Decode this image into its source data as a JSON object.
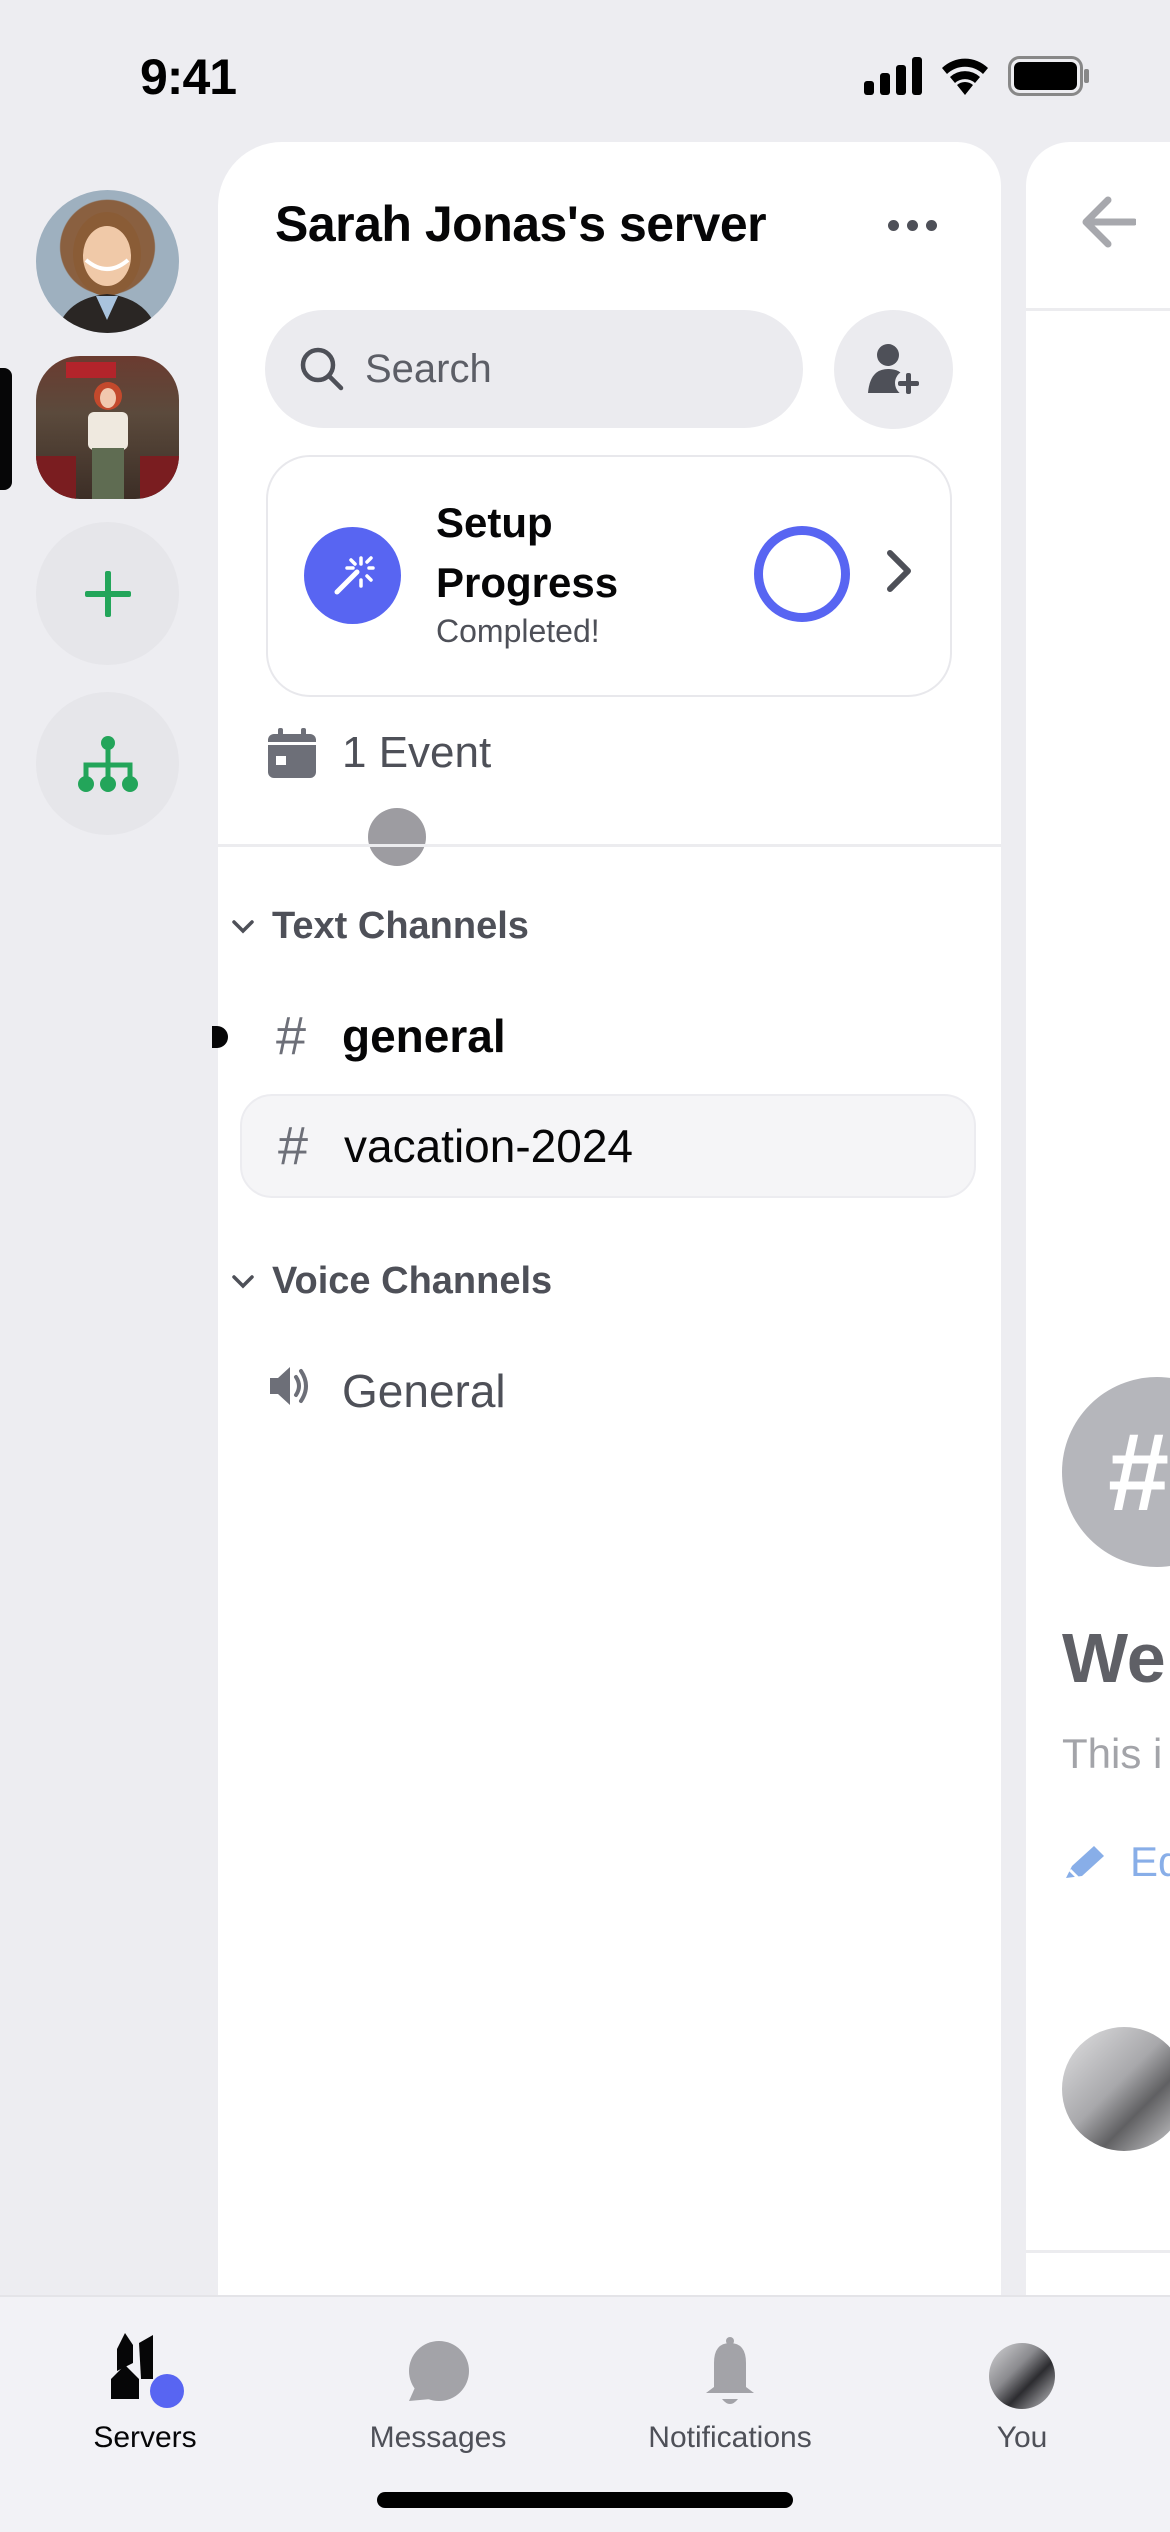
{
  "status_bar": {
    "time": "9:41"
  },
  "colors": {
    "accent": "#5865f2",
    "green": "#23a55a",
    "text_primary": "#060607",
    "text_muted": "#4e5058"
  },
  "server_rail": {
    "items": [
      {
        "name": "Sarah Jonas avatar server",
        "icon": "avatar-image"
      },
      {
        "name": "selected server",
        "icon": "avatar-image",
        "selected": true
      },
      {
        "name": "Add a Server",
        "icon": "plus-icon"
      },
      {
        "name": "Explore Servers",
        "icon": "directory-icon"
      }
    ]
  },
  "server": {
    "title": "Sarah Jonas's server",
    "more_label": "More options",
    "search_placeholder": "Search",
    "invite_label": "Invite members"
  },
  "setup_card": {
    "title": "Setup Progress",
    "status": "Completed!",
    "progress": 1.0
  },
  "events": {
    "label": "1 Event"
  },
  "categories": [
    {
      "name": "Text Channels",
      "channels": [
        {
          "name": "general",
          "type": "text",
          "unread": true,
          "selected": false
        },
        {
          "name": "vacation-2024",
          "type": "text",
          "unread": false,
          "selected": true
        }
      ]
    },
    {
      "name": "Voice Channels",
      "channels": [
        {
          "name": "General",
          "type": "voice"
        }
      ]
    }
  ],
  "right_panel": {
    "hash": "#",
    "welcome": "Wel",
    "description": "This i",
    "edit_label": "Ed"
  },
  "tabs": [
    {
      "label": "Servers",
      "icon": "servers-icon",
      "active": true
    },
    {
      "label": "Messages",
      "icon": "messages-icon",
      "active": false
    },
    {
      "label": "Notifications",
      "icon": "bell-icon",
      "active": false
    },
    {
      "label": "You",
      "icon": "avatar",
      "active": false
    }
  ]
}
